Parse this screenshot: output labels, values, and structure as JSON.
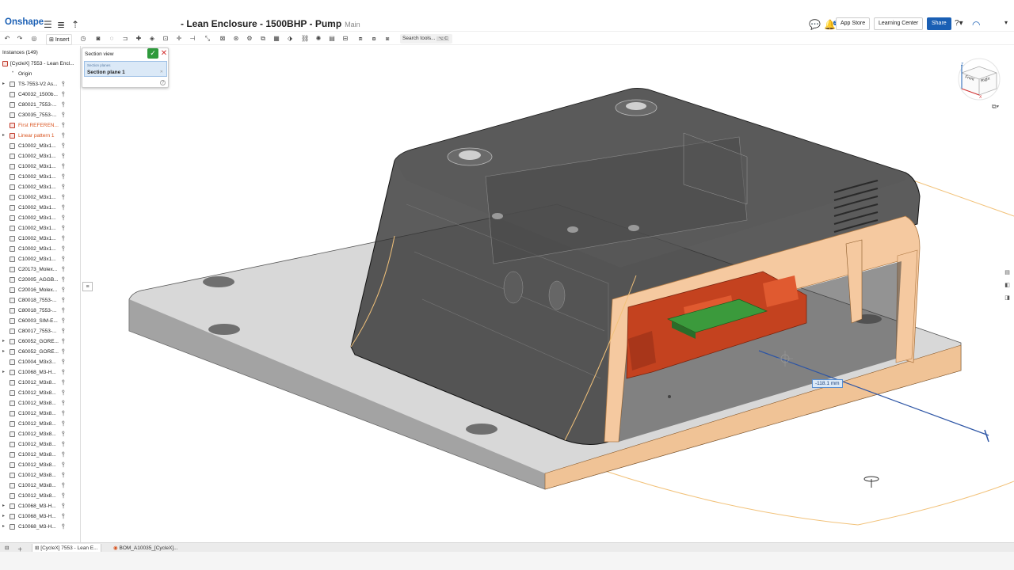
{
  "app": {
    "logo": "Onshape"
  },
  "document": {
    "title": "- Lean Enclosure - 1500BHP - Pump",
    "branch": "Main"
  },
  "header": {
    "notification_count": "3",
    "app_store_label": "App Store",
    "learning_center_label": "Learning Center",
    "share_label": "Share",
    "help_label": "?"
  },
  "toolbar": {
    "insert_label": "Insert",
    "search_label": "Search tools...",
    "search_shortcut": "⌥ C"
  },
  "instances": {
    "header": "Instances (149)",
    "root_label": "[CycleX] 7553 - Lean Encl...",
    "origin_label": "Origin",
    "items": [
      {
        "label": "TS-7553-V2 As...",
        "expandable": true,
        "style": "normal"
      },
      {
        "label": "C40032_1500b...",
        "expandable": false,
        "style": "normal"
      },
      {
        "label": "C80021_7553-...",
        "expandable": false,
        "style": "normal"
      },
      {
        "label": "C30035_7553-...",
        "expandable": false,
        "style": "normal"
      },
      {
        "label": "First REFEREN...",
        "expandable": false,
        "style": "red"
      },
      {
        "label": "Linear pattern 1",
        "expandable": true,
        "style": "red"
      },
      {
        "label": "C10002_M3x1...",
        "expandable": false,
        "style": "normal"
      },
      {
        "label": "C10002_M3x1...",
        "expandable": false,
        "style": "normal"
      },
      {
        "label": "C10002_M3x1...",
        "expandable": false,
        "style": "normal"
      },
      {
        "label": "C10002_M3x1...",
        "expandable": false,
        "style": "normal"
      },
      {
        "label": "C10002_M3x1...",
        "expandable": false,
        "style": "normal"
      },
      {
        "label": "C10002_M3x1...",
        "expandable": false,
        "style": "normal"
      },
      {
        "label": "C10002_M3x1...",
        "expandable": false,
        "style": "normal"
      },
      {
        "label": "C10002_M3x1...",
        "expandable": false,
        "style": "normal"
      },
      {
        "label": "C10002_M3x1...",
        "expandable": false,
        "style": "normal"
      },
      {
        "label": "C10002_M3x1...",
        "expandable": false,
        "style": "normal"
      },
      {
        "label": "C10002_M3x1...",
        "expandable": false,
        "style": "normal"
      },
      {
        "label": "C10002_M3x1...",
        "expandable": false,
        "style": "normal"
      },
      {
        "label": "C20173_Molex...",
        "expandable": false,
        "style": "normal"
      },
      {
        "label": "C20005_AGGB...",
        "expandable": false,
        "style": "normal"
      },
      {
        "label": "C20016_Molex...",
        "expandable": false,
        "style": "normal"
      },
      {
        "label": "C80018_7553-...",
        "expandable": false,
        "style": "normal"
      },
      {
        "label": "C80018_7553-...",
        "expandable": false,
        "style": "normal"
      },
      {
        "label": "C60003_SIM-E...",
        "expandable": false,
        "style": "normal"
      },
      {
        "label": "C80017_7553-...",
        "expandable": false,
        "style": "normal"
      },
      {
        "label": "C60052_GORE...",
        "expandable": true,
        "style": "normal"
      },
      {
        "label": "C60052_GORE...",
        "expandable": true,
        "style": "normal"
      },
      {
        "label": "C10004_M3x3...",
        "expandable": false,
        "style": "normal"
      },
      {
        "label": "C10068_M3-H...",
        "expandable": true,
        "style": "normal"
      },
      {
        "label": "C10012_M3x8...",
        "expandable": false,
        "style": "normal"
      },
      {
        "label": "C10012_M3x8...",
        "expandable": false,
        "style": "normal"
      },
      {
        "label": "C10012_M3x8...",
        "expandable": false,
        "style": "normal"
      },
      {
        "label": "C10012_M3x8...",
        "expandable": false,
        "style": "normal"
      },
      {
        "label": "C10012_M3x8...",
        "expandable": false,
        "style": "normal"
      },
      {
        "label": "C10012_M3x8...",
        "expandable": false,
        "style": "normal"
      },
      {
        "label": "C10012_M3x8...",
        "expandable": false,
        "style": "normal"
      },
      {
        "label": "C10012_M3x8...",
        "expandable": false,
        "style": "normal"
      },
      {
        "label": "C10012_M3x8...",
        "expandable": false,
        "style": "normal"
      },
      {
        "label": "C10012_M3x8...",
        "expandable": false,
        "style": "normal"
      },
      {
        "label": "C10012_M3x8...",
        "expandable": false,
        "style": "normal"
      },
      {
        "label": "C10012_M3x8...",
        "expandable": false,
        "style": "normal"
      },
      {
        "label": "C10068_M3-H...",
        "expandable": true,
        "style": "normal"
      },
      {
        "label": "C10068_M3-H...",
        "expandable": true,
        "style": "normal"
      },
      {
        "label": "C10068_M3-H...",
        "expandable": true,
        "style": "normal"
      }
    ]
  },
  "section_view": {
    "title": "Section view",
    "field_label": "Section planes",
    "field_value": "Section plane 1"
  },
  "viewport": {
    "dimension_value": "-118.1 mm"
  },
  "navcube": {
    "front_label": "Front",
    "right_label": "Right",
    "z_label": "Z",
    "x_label": "X"
  },
  "tabs": [
    {
      "label": "[CycleX] 7553 - Lean E..."
    },
    {
      "label": "BOM_A10035_[CycleX]..."
    }
  ],
  "colors": {
    "accent": "#1a5fb4",
    "section_fill": "#f5c9a0",
    "base_plate": "#d9d9d9",
    "housing": "#3a3a3a",
    "pcb_red": "#c4421f",
    "pcb_green": "#3b9a3c"
  }
}
